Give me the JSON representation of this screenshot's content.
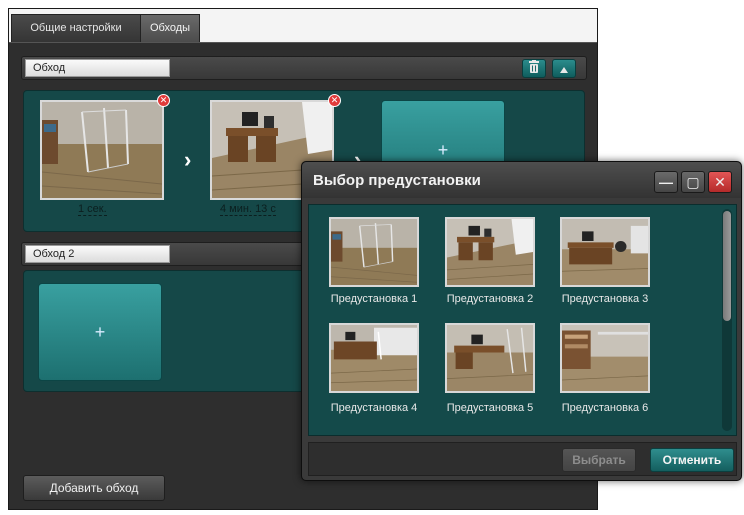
{
  "tabs": {
    "general": "Общие настройки",
    "patrols": "Обходы"
  },
  "patrols": [
    {
      "name": "Обход",
      "steps": [
        {
          "dwell": "1 сек."
        },
        {
          "dwell": "4 мин. 13 с"
        }
      ],
      "add_label": "+"
    },
    {
      "name": "Обход 2",
      "steps": [],
      "add_label": "+"
    }
  ],
  "add_patrol_label": "Добавить обход",
  "preset_dialog": {
    "title": "Выбор предустановки",
    "window_controls": {
      "minimize": "—",
      "maximize": "▢",
      "close": "✕"
    },
    "presets": [
      {
        "label": "Предустановка 1"
      },
      {
        "label": "Предустановка 2"
      },
      {
        "label": "Предустановка 3"
      },
      {
        "label": "Предустановка 4"
      },
      {
        "label": "Предустановка 5"
      },
      {
        "label": "Предустановка 6"
      }
    ],
    "select_label": "Выбрать",
    "cancel_label": "Отменить"
  },
  "icons": {
    "delete_patrol": "trash-icon",
    "collapse_patrol": "caret-up-icon",
    "remove_step": "remove-icon",
    "next_step": "chevron-right-icon"
  },
  "colors": {
    "window_bg": "#2b2b2b",
    "teal_panel": "#154848",
    "teal_tile": "#2a8a8a",
    "close_red": "#d03c3c",
    "remove_badge": "#e03b3b"
  }
}
